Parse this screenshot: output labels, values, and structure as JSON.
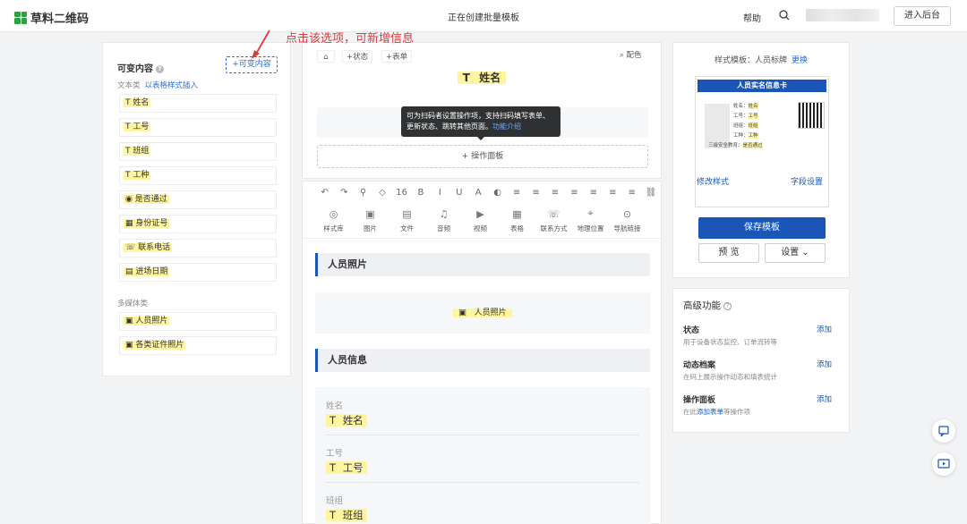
{
  "header": {
    "brand": "草料二维码",
    "page_title": "正在创建批量模板",
    "help": "帮助",
    "enter_backend": "进入后台"
  },
  "annotation": "点击该选项，可新增信息",
  "left_panel": {
    "title": "可变内容",
    "add_button": "+可变内容",
    "text_section": "文本类",
    "text_section_link": "以表格样式插入",
    "text_items": [
      "姓名",
      "工号",
      "班组",
      "工种",
      "是否通过",
      "身份证号",
      "联系电话",
      "进场日期"
    ],
    "text_item_icons": [
      "T",
      "T",
      "T",
      "T",
      "◉",
      "▦",
      "☏",
      "▤"
    ],
    "media_section": "多媒体类",
    "media_items": [
      "人员照片",
      "各类证件照片"
    ]
  },
  "preview": {
    "status_chip": "+状态",
    "form_chip": "+表单",
    "color_scheme": "配色",
    "name_title": "姓名",
    "tooltip_text": "可为扫码者设置操作项，支持扫码填写表单、更新状态、跳转其他页面。",
    "tooltip_link": "功能介绍",
    "op_panel": "+ 操作面板"
  },
  "toolbar": {
    "row1": [
      "↶",
      "↷",
      "⚲",
      "◇",
      "16",
      "B",
      "I",
      "U",
      "A",
      "◐",
      "≡",
      "≡",
      "≡",
      "≡",
      "≡",
      "≡",
      "≡",
      "⛓"
    ],
    "tools": [
      "样式库",
      "图片",
      "文件",
      "音频",
      "视频",
      "表格",
      "联系方式",
      "地理位置",
      "导航链接"
    ],
    "tool_icons": [
      "◎",
      "▣",
      "▤",
      "♫",
      "▶",
      "▦",
      "☏",
      "⌖",
      "⊙"
    ]
  },
  "content": {
    "photo_section": "人员照片",
    "photo_placeholder": "人员照片",
    "info_section": "人员信息",
    "fields": [
      {
        "label": "姓名",
        "value": "姓名"
      },
      {
        "label": "工号",
        "value": "工号"
      },
      {
        "label": "班组",
        "value": "班组"
      }
    ]
  },
  "style_panel": {
    "label": "样式模板：人员标牌",
    "change": "更换",
    "card_title": "人员实名信息卡",
    "card_rows": [
      {
        "k": "姓名：",
        "v": "姓名"
      },
      {
        "k": "工号：",
        "v": "工号"
      },
      {
        "k": "班组：",
        "v": "班组"
      },
      {
        "k": "工种：",
        "v": "工种"
      },
      {
        "k": "三级安全教育：",
        "v": "是否通过"
      }
    ],
    "modify_style": "修改样式",
    "field_settings": "字段设置",
    "save": "保存模板",
    "preview": "预 览",
    "settings": "设置 ⌄"
  },
  "advanced": {
    "title": "高级功能",
    "items": [
      {
        "name": "状态",
        "desc": "用于设备状态监控、订单流转等",
        "add": "添加"
      },
      {
        "name": "动态档案",
        "desc": "在码上展示操作动态和填表统计",
        "add": "添加"
      },
      {
        "name": "操作面板",
        "desc_pre": "在此",
        "desc_link": "添加表单",
        "desc_post": "等操作项",
        "add": "添加"
      }
    ]
  },
  "colors": {
    "accent": "#1a56b8",
    "highlight": "#fff5a0",
    "annotation": "#e03a3a"
  }
}
